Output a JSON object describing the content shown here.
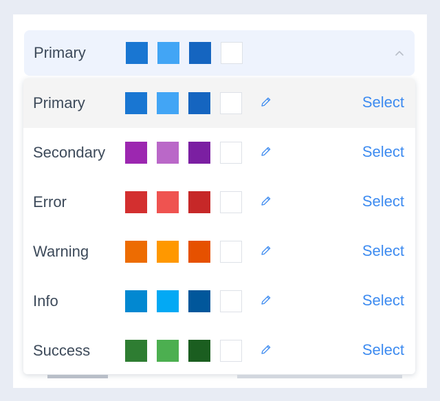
{
  "selected": {
    "label": "Primary",
    "colors": [
      "#1976d2",
      "#42a5f5",
      "#1565c0",
      "#ffffff"
    ]
  },
  "menu": {
    "items": [
      {
        "label": "Primary",
        "colors": [
          "#1976d2",
          "#42a5f5",
          "#1565c0",
          "#ffffff"
        ],
        "action": "Select",
        "active": true
      },
      {
        "label": "Secondary",
        "colors": [
          "#9c27b0",
          "#ba68c8",
          "#7b1fa2",
          "#ffffff"
        ],
        "action": "Select",
        "active": false
      },
      {
        "label": "Error",
        "colors": [
          "#d32f2f",
          "#ef5350",
          "#c62828",
          "#ffffff"
        ],
        "action": "Select",
        "active": false
      },
      {
        "label": "Warning",
        "colors": [
          "#ed6c02",
          "#ff9800",
          "#e65100",
          "#ffffff"
        ],
        "action": "Select",
        "active": false
      },
      {
        "label": "Info",
        "colors": [
          "#0288d1",
          "#03a9f4",
          "#01579b",
          "#ffffff"
        ],
        "action": "Select",
        "active": false
      },
      {
        "label": "Success",
        "colors": [
          "#2e7d32",
          "#4caf50",
          "#1b5e20",
          "#ffffff"
        ],
        "action": "Select",
        "active": false
      }
    ]
  },
  "icons": {
    "edit": "pencil-icon",
    "toggle": "chevron-up-icon"
  },
  "theme": {
    "accent": "#3d8bf0",
    "selector_bg": "#eef3fd",
    "active_row_bg": "#f4f4f4",
    "page_bg": "#e8ecf4"
  }
}
